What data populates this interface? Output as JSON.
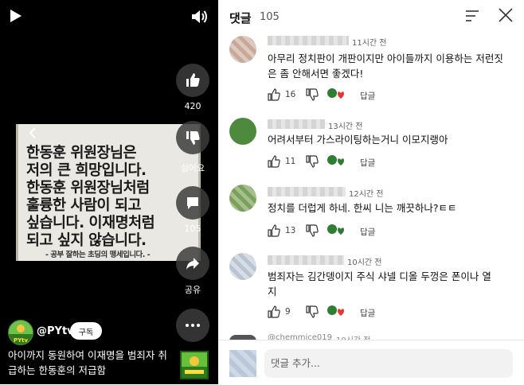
{
  "player": {
    "sign_lines": [
      "한동훈 위원장님은",
      "저의 큰 희망입니다.",
      "한동훈 위원장님처럼",
      "훌륭한 사람이 되고",
      "싶습니다. 이재명처럼",
      "되고 싶지 않습니다."
    ],
    "sign_footer": "- 공부 잘하는 초딩의 맹세입니다. -",
    "like_count": "420",
    "dislike_label": "싫어요",
    "comment_count": "105",
    "share_label": "공유",
    "channel_name": "@PYtv",
    "subscribe_label": "구독",
    "video_title": "아이까지 동원하여 이재명을 범죄자 취급하는 한동훈의 저급함",
    "channel_logo_text": "PYtv"
  },
  "comments_panel": {
    "title": "댓글",
    "count": "105",
    "reply_label": "답글",
    "items": [
      {
        "time": "11시간 전",
        "text": "아무리 정치판이 개판이지만 아이들까지 이용하는 저런짓은 좀 안해서면 좋겠다!",
        "likes": "16",
        "avatar": "#c9a89a"
      },
      {
        "time": "13시간 전",
        "text": "어려서부터 가스라이팅하는거니 이모지랭아",
        "likes": "11",
        "avatar": "#4e8a3e"
      },
      {
        "time": "12시간 전",
        "text": "정치를 더럽게 하네. 한씨 니는 깨끗하나?ㅌㅌ",
        "likes": "13",
        "avatar": "#7aa05a"
      },
      {
        "time": "10시간 전",
        "text": "범죄자는 김간뎅이지 주식 샤넬 디올 두껑은 폰이나 열지",
        "likes": "9",
        "avatar": "#b9c4d3"
      }
    ],
    "partial_name": "@chemmice019",
    "partial_time": "10시간 전",
    "add_comment_placeholder": "댓글 추가...",
    "colors": {
      "heart": "#e53935",
      "badge": "#2e7d32"
    }
  }
}
